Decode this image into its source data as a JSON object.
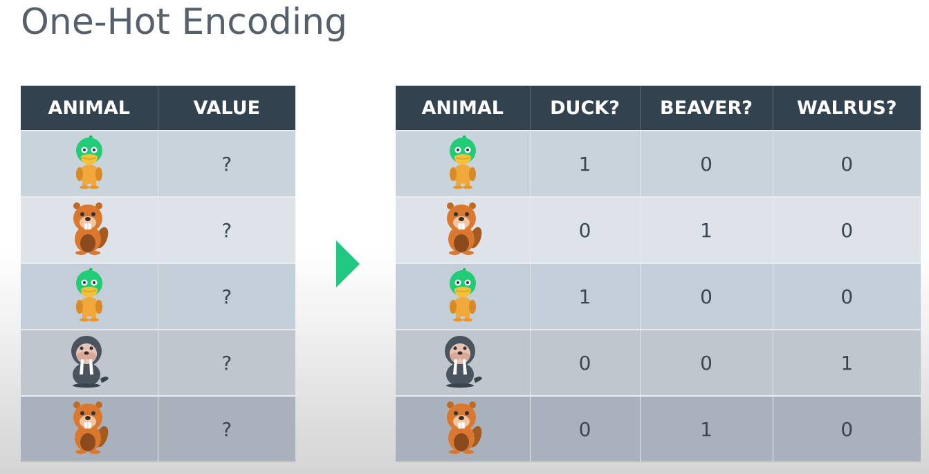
{
  "title": "One-Hot Encoding",
  "colors": {
    "header_bg": "#33424f",
    "arrow": "#1fc780",
    "title_text": "#56606a"
  },
  "left_table": {
    "headers": [
      "ANIMAL",
      "VALUE"
    ],
    "rows": [
      {
        "animal": "duck-icon",
        "value": "?"
      },
      {
        "animal": "beaver-icon",
        "value": "?"
      },
      {
        "animal": "duck-icon",
        "value": "?"
      },
      {
        "animal": "walrus-icon",
        "value": "?"
      },
      {
        "animal": "beaver-icon",
        "value": "?"
      }
    ]
  },
  "arrow_icon": "play-triangle-icon",
  "right_table": {
    "headers": [
      "ANIMAL",
      "DUCK?",
      "BEAVER?",
      "WALRUS?"
    ],
    "rows": [
      {
        "animal": "duck-icon",
        "duck": "1",
        "beaver": "0",
        "walrus": "0"
      },
      {
        "animal": "beaver-icon",
        "duck": "0",
        "beaver": "1",
        "walrus": "0"
      },
      {
        "animal": "duck-icon",
        "duck": "1",
        "beaver": "0",
        "walrus": "0"
      },
      {
        "animal": "walrus-icon",
        "duck": "0",
        "beaver": "0",
        "walrus": "1"
      },
      {
        "animal": "beaver-icon",
        "duck": "0",
        "beaver": "1",
        "walrus": "0"
      }
    ]
  }
}
